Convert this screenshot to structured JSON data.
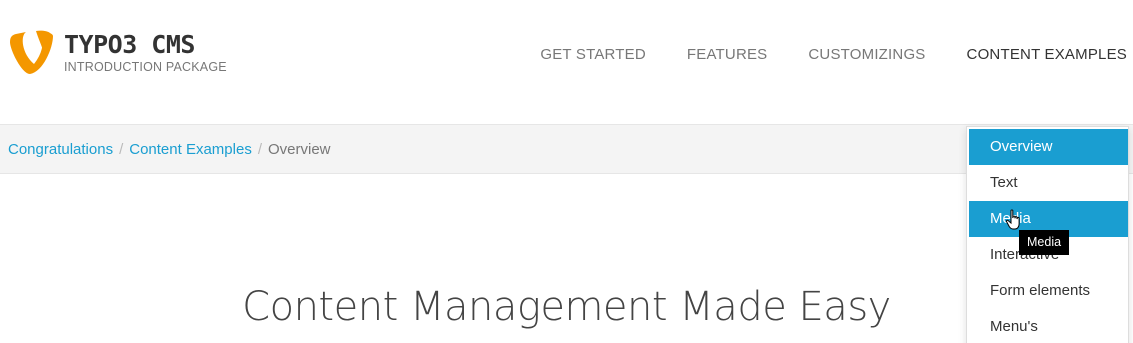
{
  "logo": {
    "title": "TYPO3 CMS",
    "subtitle": "INTRODUCTION PACKAGE",
    "brand_color": "#f49700"
  },
  "nav": {
    "items": [
      {
        "label": "GET STARTED"
      },
      {
        "label": "FEATURES"
      },
      {
        "label": "CUSTOMIZINGS"
      },
      {
        "label": "CONTENT EXAMPLES"
      }
    ]
  },
  "breadcrumb": {
    "items": [
      {
        "label": "Congratulations"
      },
      {
        "label": "Content Examples"
      }
    ],
    "separator": "/",
    "current": "Overview"
  },
  "headline": "Content Management Made Easy",
  "dropdown": {
    "items": [
      {
        "label": "Overview"
      },
      {
        "label": "Text"
      },
      {
        "label": "Media"
      },
      {
        "label": "Interactive"
      },
      {
        "label": "Form elements"
      },
      {
        "label": "Menu's"
      }
    ]
  },
  "tooltip": "Media",
  "colors": {
    "accent": "#1a9ed1",
    "nav_text": "#777777",
    "nav_active": "#333333",
    "crumb_bar": "#f4f4f4"
  }
}
